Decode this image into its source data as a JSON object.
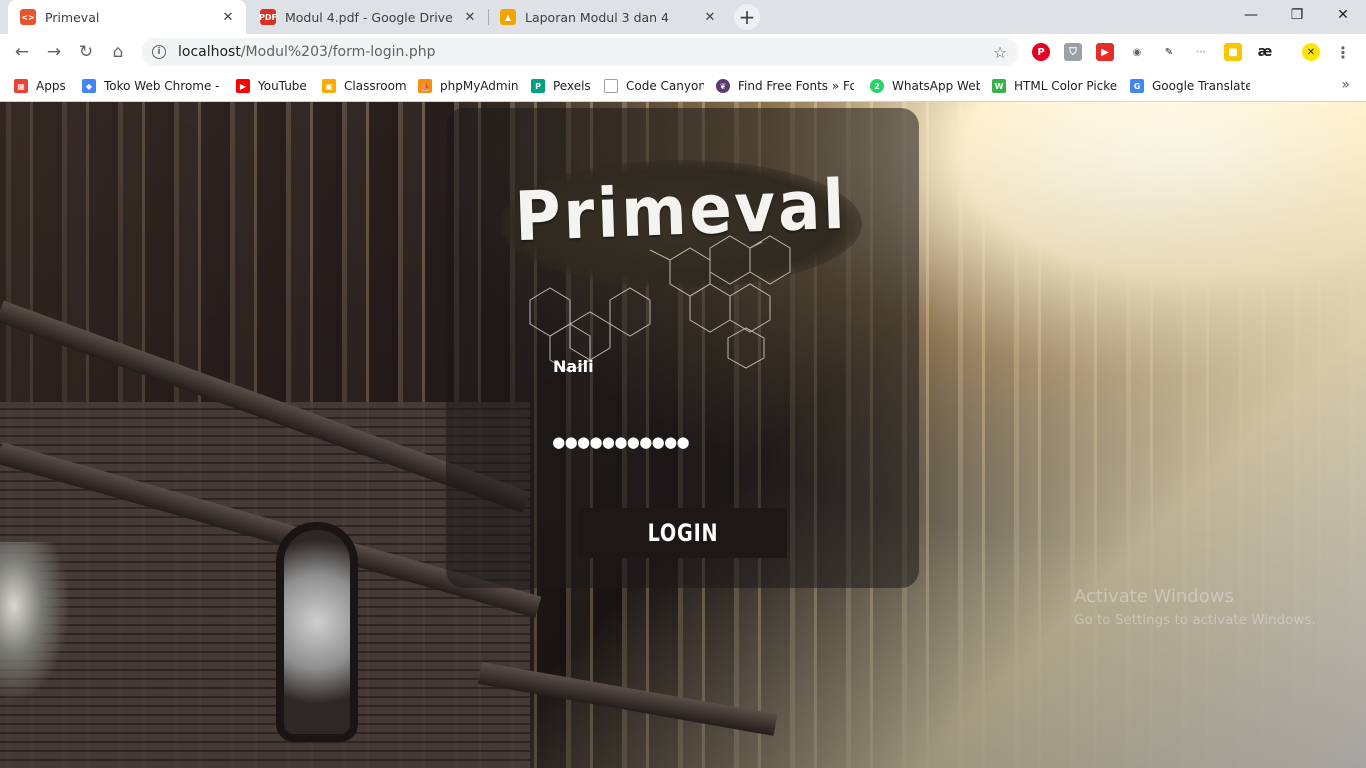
{
  "tabs": [
    {
      "title": "Primeval",
      "active": true,
      "icon": "code-favicon-icon",
      "color": "#e8542a"
    },
    {
      "title": "Modul 4.pdf - Google Drive",
      "active": false,
      "icon": "pdf-icon",
      "color": "#d93025"
    },
    {
      "title": "Laporan Modul 3 dan 4",
      "active": false,
      "icon": "slides-icon",
      "color": "#f4a400"
    }
  ],
  "omnibox": {
    "url_host": "localhost",
    "url_path": "/Modul%203/form-login.php"
  },
  "bookmarks": [
    {
      "label": "Apps",
      "icon": "apps-grid-icon",
      "color": "#ea4335"
    },
    {
      "label": "Toko Web Chrome - c",
      "icon": "chrome-webstore-icon",
      "color": "#4285f4"
    },
    {
      "label": "YouTube",
      "icon": "youtube-icon",
      "color": "#ff0000"
    },
    {
      "label": "Classroom",
      "icon": "classroom-icon",
      "color": "#f9ab00"
    },
    {
      "label": "phpMyAdmin",
      "icon": "phpmyadmin-icon",
      "color": "#f29111"
    },
    {
      "label": "Pexels",
      "icon": "pexels-icon",
      "color": "#05a081"
    },
    {
      "label": "Code Canyon",
      "icon": "page-icon",
      "color": "#9aa0a6"
    },
    {
      "label": "Find Free Fonts » Fon",
      "icon": "fonts-icon",
      "color": "#5b3a72"
    },
    {
      "label": "WhatsApp Web",
      "icon": "whatsapp-icon",
      "color": "#25d366"
    },
    {
      "label": "HTML Color Picker",
      "icon": "color-picker-icon",
      "color": "#37b34a"
    },
    {
      "label": "Google Translate",
      "icon": "translate-icon",
      "color": "#4285f4"
    }
  ],
  "login": {
    "logo_text": "Primeval",
    "username_value": "Naili",
    "password_value": "●●●●●●●●●●●",
    "button_label": "LOGIN"
  },
  "watermark": {
    "line1": "Activate Windows",
    "line2": "Go to Settings to activate Windows."
  }
}
